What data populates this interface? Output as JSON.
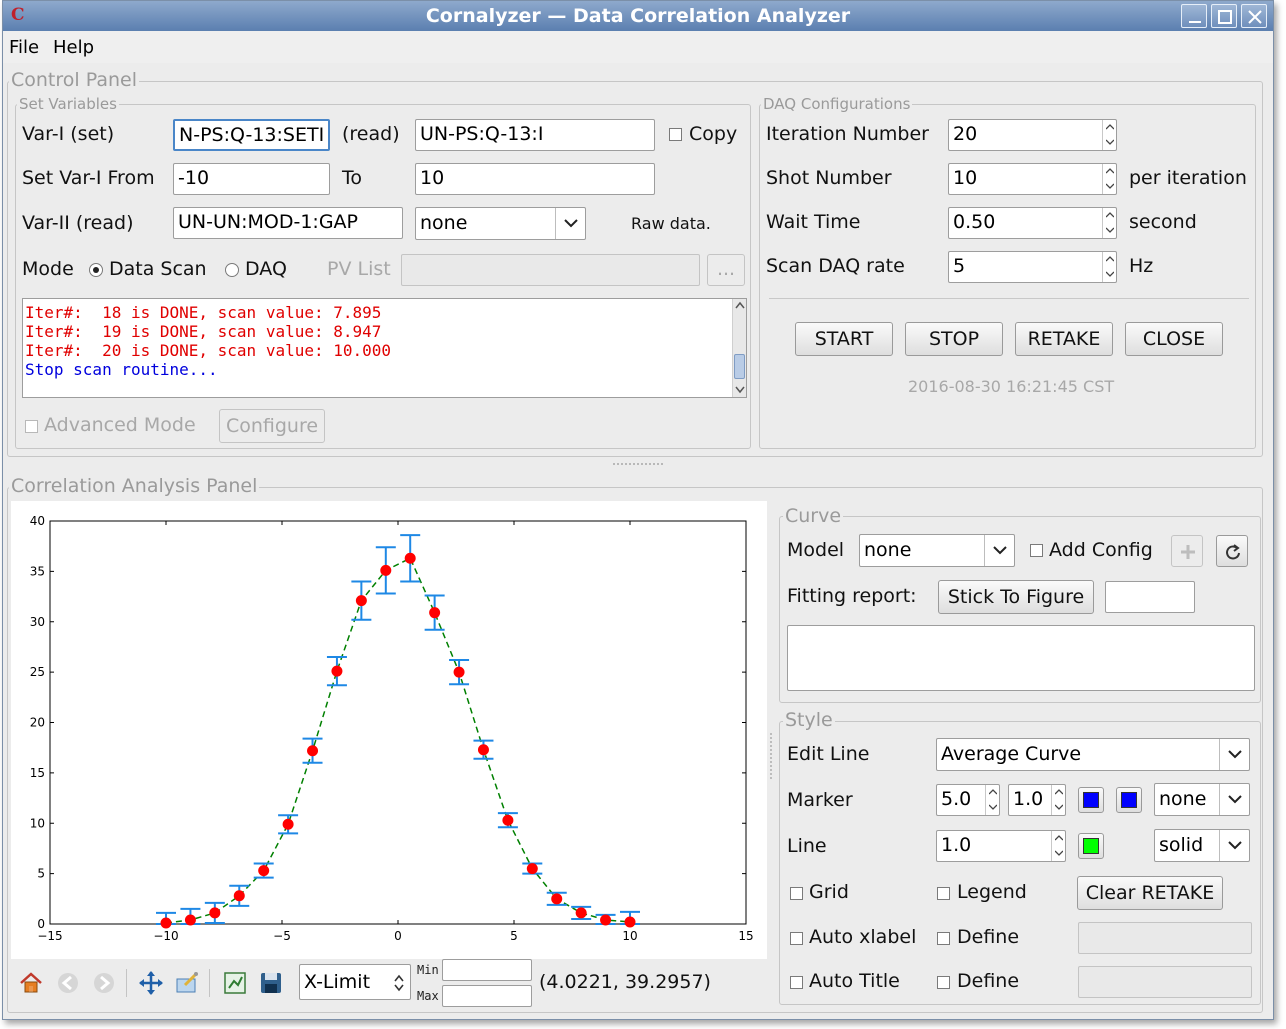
{
  "window": {
    "title": "Cornalyzer — Data Correlation Analyzer",
    "app_icon_letter": "C"
  },
  "menu": {
    "items": [
      "File",
      "Help"
    ]
  },
  "control_panel": {
    "title": "Control Panel",
    "set_variables": {
      "title": "Set Variables",
      "var1_set_label": "Var-I (set)",
      "var1_set_value": "N-PS:Q-13:SETI",
      "read_label": "(read)",
      "var1_read_value": "UN-PS:Q-13:I",
      "copy_label": "Copy",
      "from_label": "Set Var-I From",
      "from_value": "-10",
      "to_label": "To",
      "to_value": "10",
      "var2_label": "Var-II (read)",
      "var2_value": "UN-UN:MOD-1:GAP",
      "var2_combo": "none",
      "raw_data_label": "Raw data.",
      "mode_label": "Mode",
      "mode_data_scan": "Data Scan",
      "mode_daq": "DAQ",
      "pv_list_label": "PV List",
      "pv_list_button": "...",
      "log": [
        {
          "text": "Iter#:  18 is DONE, scan value: 7.895",
          "color": "#e00000"
        },
        {
          "text": "Iter#:  19 is DONE, scan value: 8.947",
          "color": "#e00000"
        },
        {
          "text": "Iter#:  20 is DONE, scan value: 10.000",
          "color": "#e00000"
        },
        {
          "text": "Stop scan routine...",
          "color": "#0000dd"
        }
      ],
      "advanced_mode_label": "Advanced Mode",
      "configure_button": "Configure"
    },
    "daq": {
      "title": "DAQ Configurations",
      "iteration_label": "Iteration Number",
      "iteration_value": "20",
      "shot_label": "Shot Number",
      "shot_value": "10",
      "shot_unit": "per iteration",
      "wait_label": "Wait Time",
      "wait_value": "0.50",
      "wait_unit": "second",
      "rate_label": "Scan DAQ rate",
      "rate_value": "5",
      "rate_unit": "Hz",
      "start_button": "START",
      "stop_button": "STOP",
      "retake_button": "RETAKE",
      "close_button": "CLOSE",
      "timestamp": "2016-08-30 16:21:45 CST"
    }
  },
  "analysis_panel": {
    "title": "Correlation Analysis Panel",
    "toolbar": {
      "xlimit_combo": "X-Limit",
      "min_label": "Min",
      "max_label": "Max",
      "min_value": "",
      "max_value": "",
      "coords": "(4.0221, 39.2957)"
    },
    "curve": {
      "title": "Curve",
      "model_label": "Model",
      "model_value": "none",
      "add_config_label": "Add Config",
      "fitting_label": "Fitting report:",
      "stick_button": "Stick To Figure",
      "stick_field": "",
      "report_text": ""
    },
    "style": {
      "title": "Style",
      "edit_line_label": "Edit Line",
      "edit_line_value": "Average Curve",
      "marker_label": "Marker",
      "marker_size": "5.0",
      "marker_width": "1.0",
      "marker_face_color": "#0000ff",
      "marker_edge_color": "#0000ff",
      "marker_style": "none",
      "line_label": "Line",
      "line_width": "1.0",
      "line_color": "#00ff00",
      "line_style": "solid",
      "grid_label": "Grid",
      "legend_label": "Legend",
      "clear_button": "Clear RETAKE",
      "auto_xlabel_label": "Auto xlabel",
      "define_label_1": "Define",
      "auto_title_label": "Auto Title",
      "define_label_2": "Define"
    }
  },
  "chart_data": {
    "type": "scatter",
    "x_ticks": [
      -15,
      -10,
      -5,
      0,
      5,
      10,
      15
    ],
    "y_ticks": [
      0,
      5,
      10,
      15,
      20,
      25,
      30,
      35,
      40
    ],
    "xlim": [
      -15,
      15
    ],
    "ylim": [
      0,
      40
    ],
    "grid": false,
    "series": [
      {
        "x": [
          -10,
          -8.947,
          -7.895,
          -6.842,
          -5.789,
          -4.737,
          -3.684,
          -2.632,
          -1.579,
          -0.526,
          0.526,
          1.579,
          2.632,
          3.684,
          4.737,
          5.789,
          6.842,
          7.895,
          8.947,
          10
        ],
        "y": [
          0.1,
          0.4,
          1.1,
          2.8,
          5.3,
          9.9,
          17.2,
          25.1,
          32.1,
          35.1,
          36.3,
          30.9,
          25.0,
          17.3,
          10.3,
          5.5,
          2.5,
          1.1,
          0.4,
          0.2
        ],
        "yerr": [
          1.0,
          1.1,
          1.0,
          1.0,
          0.7,
          0.9,
          1.2,
          1.4,
          1.9,
          2.3,
          2.3,
          1.7,
          1.2,
          0.9,
          0.7,
          0.5,
          0.6,
          0.6,
          0.5,
          1.0
        ],
        "marker_color": "#ff0000",
        "errorbar_color": "#1e88e5",
        "line_color": "#008000",
        "line_style": "dashed"
      }
    ]
  }
}
